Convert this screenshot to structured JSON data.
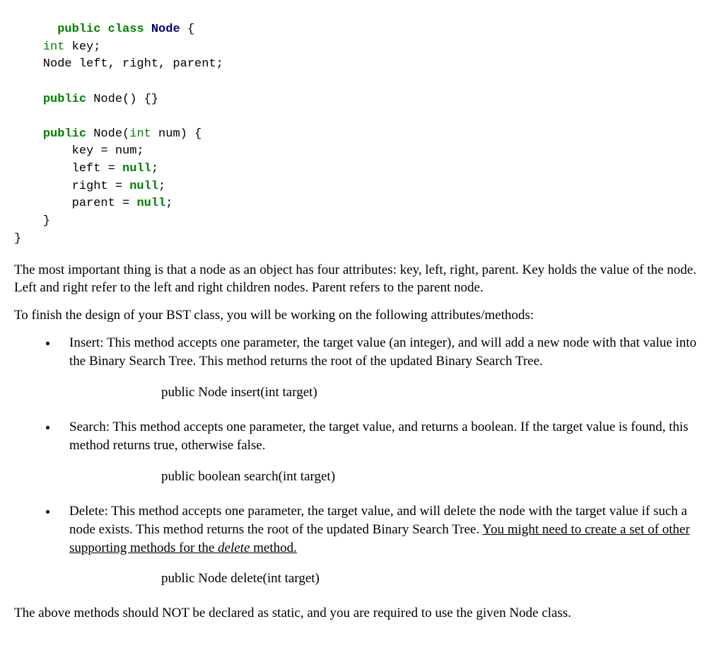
{
  "code": {
    "kw_public": "public",
    "kw_class": "class",
    "cls_node": "Node",
    "brace_open": "{",
    "brace_close": "}",
    "type_int": "int",
    "field_key": " key;",
    "line_children": "    Node left, right, parent;",
    "ctor1_paren": "() {}",
    "ctor2_paren_open": "(",
    "ctor2_param": " num) {",
    "body_key": "        key = num;",
    "body_left_prefix": "        left = ",
    "body_right_prefix": "        right = ",
    "body_parent_prefix": "        parent = ",
    "kw_null": "null",
    "semi": ";",
    "close_inner": "    }"
  },
  "para1": "The most important thing is that a node as an object has four attributes: key, left, right, parent. Key holds the value of the node. Left and right refer to the left and right children nodes. Parent refers to the parent node.",
  "para2": "To finish the design of your BST class, you will be working on the following attributes/methods:",
  "insert_desc": "Insert: This method accepts one parameter, the target value (an integer), and will add a new node with that value into the Binary Search Tree. This method returns the root of the updated Binary Search Tree.",
  "insert_sig": "public Node insert(int target)",
  "search_desc": "Search: This method accepts one parameter, the target value, and returns a boolean. If the target value is found, this method returns true, otherwise false.",
  "search_sig": "public boolean search(int target)",
  "delete_desc_pre": "Delete: This method accepts one parameter, the target value, and will delete the node with the target value if such a node exists. This method returns the root of the updated Binary Search Tree. ",
  "delete_desc_ul_pre": "You might need to create a set of other supporting methods for the ",
  "delete_desc_ul_italic": "delete",
  "delete_desc_ul_post": " method.",
  "delete_sig": "public Node delete(int target)",
  "para3": "The above methods should NOT be declared as static, and you are required to use the given Node class."
}
